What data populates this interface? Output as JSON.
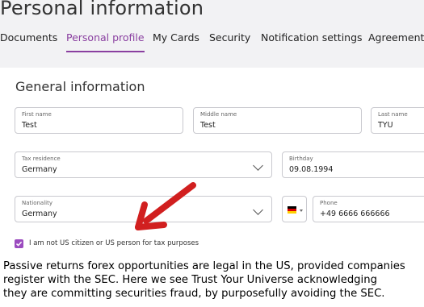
{
  "page": {
    "title": "Personal information"
  },
  "tabs": [
    {
      "label": "Documents",
      "active": false
    },
    {
      "label": "Personal profile",
      "active": true
    },
    {
      "label": "My Cards",
      "active": false
    },
    {
      "label": "Security",
      "active": false
    },
    {
      "label": "Notification settings",
      "active": false
    },
    {
      "label": "Agreements",
      "active": false
    }
  ],
  "section": {
    "title": "General information"
  },
  "fields": {
    "first_name": {
      "label": "First name",
      "value": "Test"
    },
    "middle_name": {
      "label": "Middle name",
      "value": "Test"
    },
    "last_name": {
      "label": "Last name",
      "value": "TYU"
    },
    "tax_residence": {
      "label": "Tax residence",
      "value": "Germany"
    },
    "birthday": {
      "label": "Birthday",
      "value": "09.08.1994"
    },
    "nationality": {
      "label": "Nationality",
      "value": "Germany"
    },
    "phone": {
      "label": "Phone",
      "value": "+49 6666 666666",
      "country_flag": "germany-flag-icon"
    }
  },
  "checkbox": {
    "label": "I am not US citizen or US person for tax purposes",
    "checked": true
  },
  "annotation": {
    "icon": "red-arrow-icon"
  },
  "caption": {
    "lines": [
      "Passive returns forex opportunities are legal in the US, provided companies",
      "register with the SEC. Here we see Trust Your Universe acknowledging",
      "they are committing securities fraud, by purposefully avoiding the SEC."
    ]
  },
  "colors": {
    "accent": "#9b4bbf",
    "tab_active": "#8a3fa0",
    "arrow": "#d11f1f"
  }
}
